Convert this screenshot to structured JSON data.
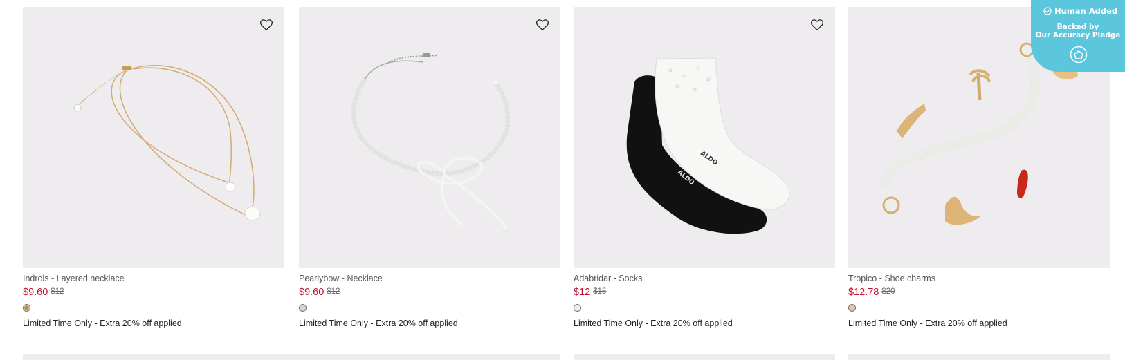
{
  "products": [
    {
      "name": "Indrols - Layered necklace",
      "price": "$9.60",
      "original_price": "$12",
      "swatch_color": "#c79a5a",
      "promo": "Limited Time Only - Extra 20% off applied",
      "wishlist_icon": "heart-icon"
    },
    {
      "name": "Pearlybow - Necklace",
      "price": "$9.60",
      "original_price": "$12",
      "swatch_color": "#d8d4c8",
      "promo": "Limited Time Only - Extra 20% off applied",
      "wishlist_icon": "heart-icon"
    },
    {
      "name": "Adabridar - Socks",
      "price": "$12",
      "original_price": "$15",
      "swatch_color": "#ededed",
      "promo": "Limited Time Only - Extra 20% off applied",
      "wishlist_icon": "heart-icon"
    },
    {
      "name": "Tropico - Shoe charms",
      "price": "$12.78",
      "original_price": "$20",
      "swatch_color": "#e2c89a",
      "promo": "Limited Time Only - Extra 20% off applied",
      "wishlist_icon": "heart-icon"
    }
  ],
  "badge": {
    "title": "Human Added",
    "line1": "Backed by",
    "line2": "Our Accuracy Pledge",
    "color": "#5bc6dc"
  },
  "colors": {
    "sale_price": "#c8102e",
    "image_bg": "#eeecee"
  }
}
